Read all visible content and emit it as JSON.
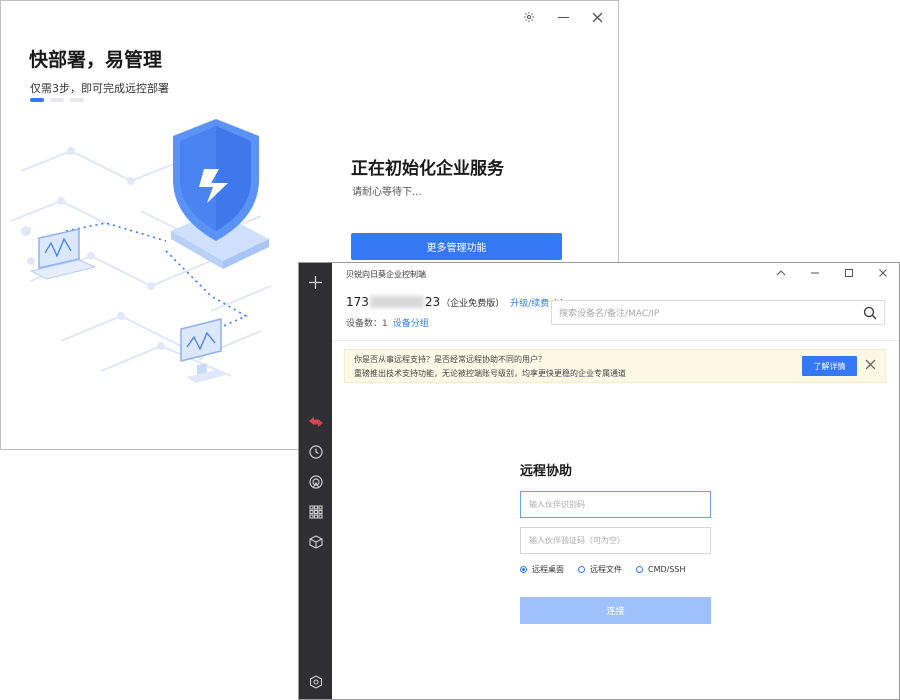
{
  "onboarding": {
    "headline": "快部署，易管理",
    "steps_text": "仅需3步，即可完成远控部署",
    "steps_total": 3,
    "steps_active": 1,
    "init_title": "正在初始化企业服务",
    "init_sub": "请耐心等待下...",
    "more_button": "更多管理功能"
  },
  "console": {
    "app_title": "贝锐向日葵企业控制端",
    "account": {
      "prefix": "173",
      "suffix": "23",
      "edition": "（企业免费版）",
      "upgrade": "升级/续费"
    },
    "device_count_label": "设备数：",
    "device_count": "1",
    "device_group": "设备分组",
    "search_placeholder": "搜索设备名/备注/MAC/IP",
    "notice": {
      "line1": "你是否从事远程支持？是否经常远程协助不同的用户？",
      "line2": "重磅推出技术支持功能，无论被控端账号级别，均享更快更稳的企业专属通道",
      "learn_more": "了解详情"
    },
    "remote": {
      "title": "远程协助",
      "partner_code_placeholder": "输入伙伴识别码",
      "verify_code_placeholder": "输入伙伴验证码（可为空）",
      "options": [
        "远程桌面",
        "远程文件",
        "CMD/SSH"
      ],
      "selected_option": "远程桌面",
      "connect": "连接"
    }
  },
  "colors": {
    "accent": "#3478f6",
    "sidebar": "#2f2f33",
    "notice_bg": "#fdf8e6",
    "connect_disabled": "#9ec1fb"
  }
}
